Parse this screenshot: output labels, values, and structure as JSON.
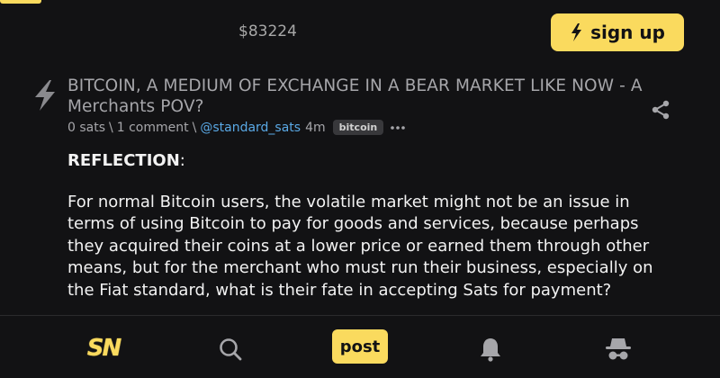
{
  "header": {
    "price": "$83224",
    "signup_label": "sign up"
  },
  "post": {
    "title": "BITCOIN, A MEDIUM OF EXCHANGE IN A BEAR MARKET LIKE NOW - A Merchants POV?",
    "sats": "0 sats",
    "sep1": "\\",
    "comments": "1 comment",
    "sep2": "\\",
    "user": "@standard_sats",
    "time": "4m",
    "tag": "bitcoin"
  },
  "content": {
    "heading": "REFLECTION",
    "heading_suffix": ":",
    "paragraph": "For normal Bitcoin users, the volatile market might not be an issue in terms of using Bitcoin to pay for goods and services, because perhaps they acquired their coins at a lower price or earned them through other means, but for the merchant who must run their business, especially on the Fiat standard, what is their fate in accepting Sats for payment?"
  },
  "nav": {
    "logo": "SN",
    "post_label": "post"
  },
  "colors": {
    "background": "#121214",
    "accent": "#fada5e",
    "link": "#5aa9e6",
    "muted": "#a6a6aa"
  },
  "icons": [
    "bolt-icon",
    "share-icon",
    "more-icon",
    "search-icon",
    "bell-icon",
    "spy-icon"
  ]
}
